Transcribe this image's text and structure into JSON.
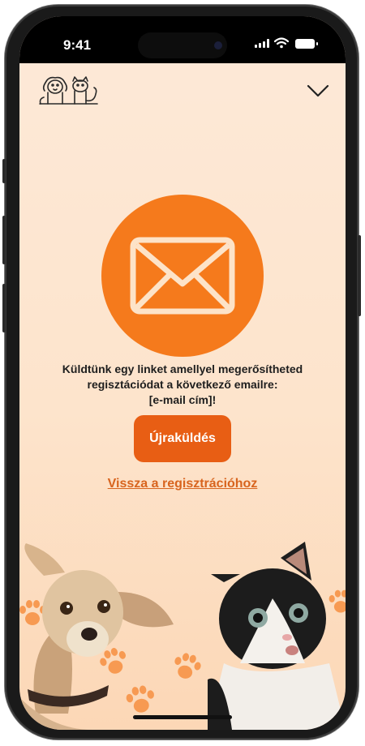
{
  "status_bar": {
    "time": "9:41"
  },
  "message": {
    "line1": "Küldtünk egy linket amellyel megerősítheted",
    "line2": "regisztációdat a következő emailre:",
    "line3": "[e-mail cím]!"
  },
  "resend_button": {
    "label": "Újraküldés"
  },
  "back_link": {
    "label": "Vissza a regisztrációhoz"
  },
  "colors": {
    "accent": "#f57a1c",
    "button": "#e85e14",
    "link": "#d8641e",
    "background_top": "#fde9d8",
    "background_bottom": "#fcd7b6"
  },
  "icons": {
    "logo": "dog-cat-logo-icon",
    "collapse": "chevron-down-icon",
    "envelope": "envelope-icon",
    "paw": "paw-print-icon"
  }
}
